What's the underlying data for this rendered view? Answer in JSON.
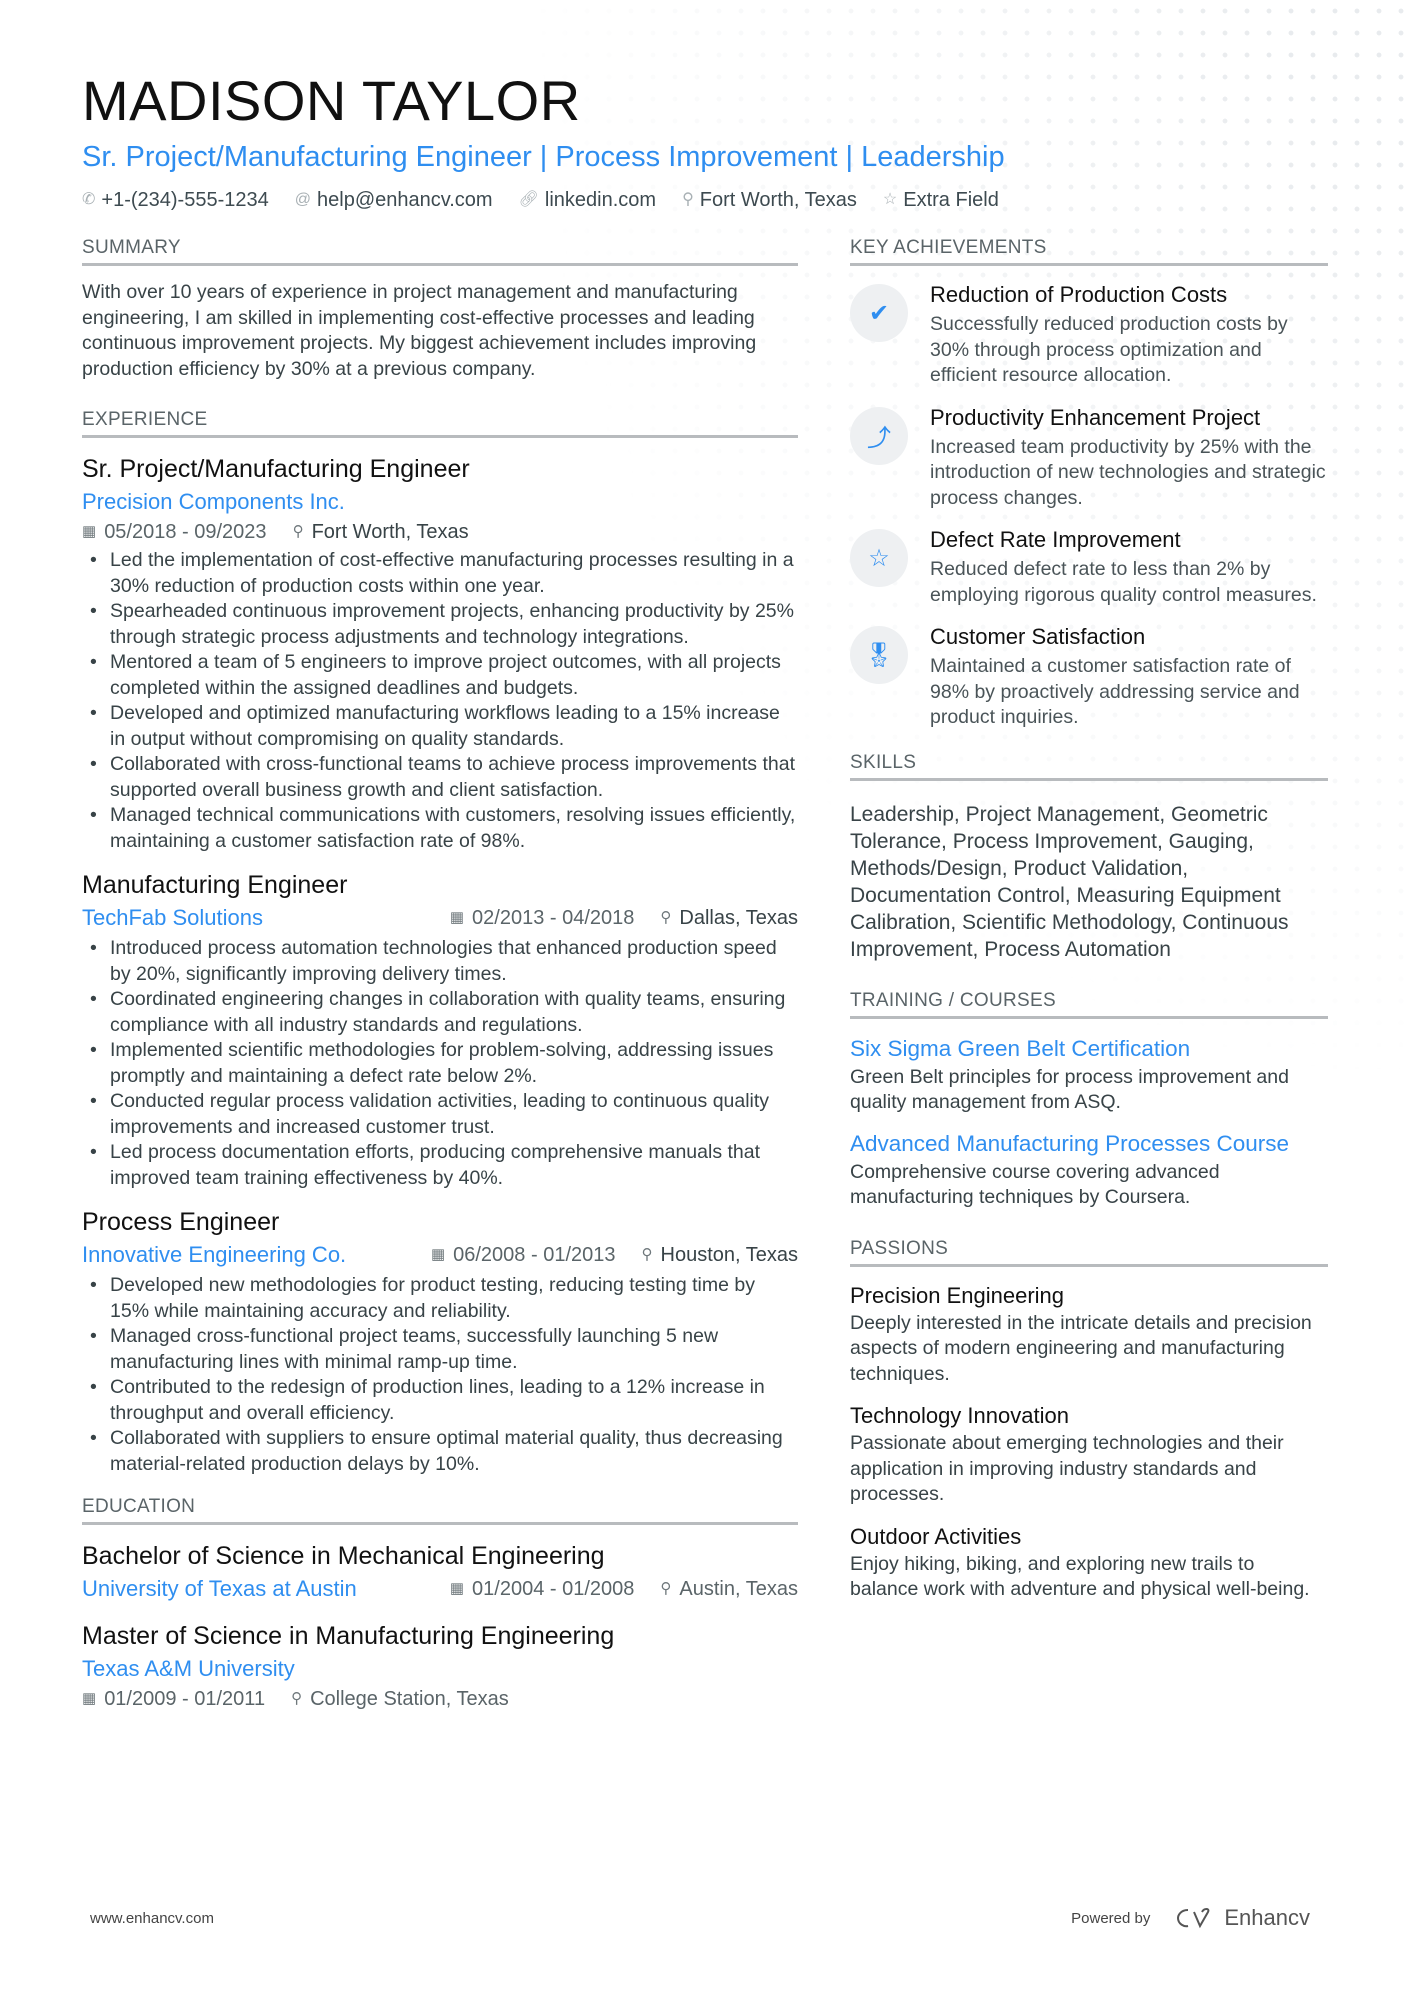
{
  "header": {
    "name": "MADISON TAYLOR",
    "headline": "Sr. Project/Manufacturing Engineer | Process Improvement | Leadership",
    "contacts": [
      {
        "icon": "phone-icon",
        "glyph": "✆",
        "text": "+1-(234)-555-1234"
      },
      {
        "icon": "at-icon",
        "glyph": "@",
        "text": "help@enhancv.com"
      },
      {
        "icon": "link-icon",
        "glyph": "🔗︎",
        "text": "linkedin.com"
      },
      {
        "icon": "location-pin-icon",
        "glyph": "⚲",
        "text": "Fort Worth, Texas"
      },
      {
        "icon": "star-icon",
        "glyph": "☆",
        "text": "Extra Field"
      }
    ]
  },
  "summary": {
    "title": "SUMMARY",
    "text": "With over 10 years of experience in project management and manufacturing engineering, I am skilled in implementing cost-effective processes and leading continuous improvement projects. My biggest achievement includes improving production efficiency by 30% at a previous company."
  },
  "experience": {
    "title": "EXPERIENCE",
    "jobs": [
      {
        "title": "Sr. Project/Manufacturing Engineer",
        "company": "Precision Components Inc.",
        "dates": "05/2018 - 09/2023",
        "location": "Fort Worth, Texas",
        "bullets": [
          "Led the implementation of cost-effective manufacturing processes resulting in a 30% reduction of production costs within one year.",
          "Spearheaded continuous improvement projects, enhancing productivity by 25% through strategic process adjustments and technology integrations.",
          "Mentored a team of 5 engineers to improve project outcomes, with all projects completed within the assigned deadlines and budgets.",
          "Developed and optimized manufacturing workflows leading to a 15% increase in output without compromising on quality standards.",
          "Collaborated with cross-functional teams to achieve process improvements that supported overall business growth and client satisfaction.",
          "Managed technical communications with customers, resolving issues efficiently, maintaining a customer satisfaction rate of 98%."
        ]
      },
      {
        "title": "Manufacturing Engineer",
        "company": "TechFab Solutions",
        "dates": "02/2013 - 04/2018",
        "location": "Dallas, Texas",
        "bullets": [
          "Introduced process automation technologies that enhanced production speed by 20%, significantly improving delivery times.",
          "Coordinated engineering changes in collaboration with quality teams, ensuring compliance with all industry standards and regulations.",
          "Implemented scientific methodologies for problem-solving, addressing issues promptly and maintaining a defect rate below 2%.",
          "Conducted regular process validation activities, leading to continuous quality improvements and increased customer trust.",
          "Led process documentation efforts, producing comprehensive manuals that improved team training effectiveness by 40%."
        ]
      },
      {
        "title": "Process Engineer",
        "company": "Innovative Engineering Co.",
        "dates": "06/2008 - 01/2013",
        "location": "Houston, Texas",
        "bullets": [
          "Developed new methodologies for product testing, reducing testing time by 15% while maintaining accuracy and reliability.",
          "Managed cross-functional project teams, successfully launching 5 new manufacturing lines with minimal ramp-up time.",
          "Contributed to the redesign of production lines, leading to a 12% increase in throughput and overall efficiency.",
          "Collaborated with suppliers to ensure optimal material quality, thus decreasing material-related production delays by 10%."
        ]
      }
    ]
  },
  "education": {
    "title": "EDUCATION",
    "items": [
      {
        "degree": "Bachelor of Science in Mechanical Engineering",
        "school": "University of Texas at Austin",
        "dates": "01/2004 - 01/2008",
        "location": "Austin, Texas"
      },
      {
        "degree": "Master of Science in Manufacturing Engineering",
        "school": "Texas A&M University",
        "dates": "01/2009 - 01/2011",
        "location": "College Station, Texas"
      }
    ]
  },
  "achievements": {
    "title": "KEY ACHIEVEMENTS",
    "items": [
      {
        "icon": "checkmark-icon",
        "glyph": "✔",
        "title": "Reduction of Production Costs",
        "desc": "Successfully reduced production costs by 30% through process optimization and efficient resource allocation."
      },
      {
        "icon": "strategy-icon",
        "glyph": "⤴",
        "title": "Productivity Enhancement Project",
        "desc": "Increased team productivity by 25% with the introduction of new technologies and strategic process changes."
      },
      {
        "icon": "star-icon",
        "glyph": "☆",
        "title": "Defect Rate Improvement",
        "desc": "Reduced defect rate to less than 2% by employing rigorous quality control measures."
      },
      {
        "icon": "award-ribbon-icon",
        "glyph": "🎖︎",
        "title": "Customer Satisfaction",
        "desc": "Maintained a customer satisfaction rate of 98% by proactively addressing service and product inquiries."
      }
    ]
  },
  "skills": {
    "title": "SKILLS",
    "text": "Leadership, Project Management, Geometric Tolerance, Process Improvement, Gauging, Methods/Design, Product Validation, Documentation Control, Measuring Equipment Calibration, Scientific Methodology, Continuous Improvement, Process Automation"
  },
  "training": {
    "title": "TRAINING / COURSES",
    "items": [
      {
        "title": "Six Sigma Green Belt Certification",
        "desc": "Green Belt principles for process improvement and quality management from ASQ."
      },
      {
        "title": "Advanced Manufacturing Processes Course",
        "desc": "Comprehensive course covering advanced manufacturing techniques by Coursera."
      }
    ]
  },
  "passions": {
    "title": "PASSIONS",
    "items": [
      {
        "title": "Precision Engineering",
        "desc": "Deeply interested in the intricate details and precision aspects of modern engineering and manufacturing techniques."
      },
      {
        "title": "Technology Innovation",
        "desc": "Passionate about emerging technologies and their application in improving industry standards and processes."
      },
      {
        "title": "Outdoor Activities",
        "desc": "Enjoy hiking, biking, and exploring new trails to balance work with adventure and physical well-being."
      }
    ]
  },
  "footer": {
    "url": "www.enhancv.com",
    "powered_by": "Powered by",
    "brand": "Enhancv"
  },
  "colors": {
    "accent": "#2f8ef0",
    "text": "#384347",
    "rule": "#b8bbbe"
  }
}
